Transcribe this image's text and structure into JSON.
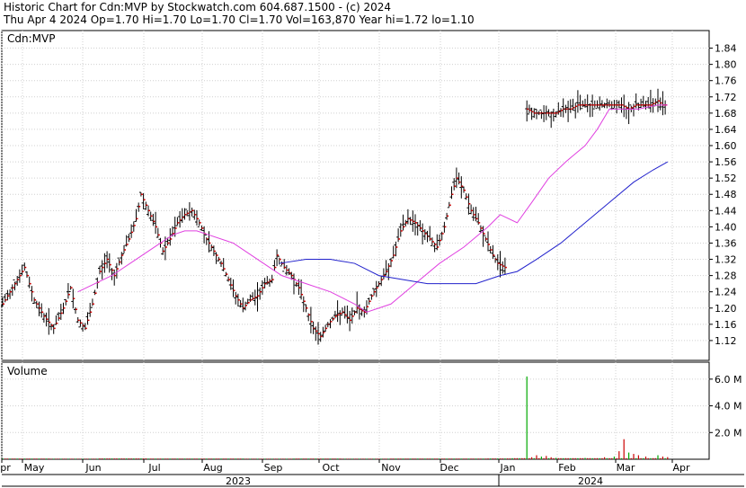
{
  "header": {
    "line1": "Historic Chart for Cdn:MVP by Stockwatch.com 604.687.1500 - (c) 2024",
    "line2": "Thu Apr  4 2024   Op=1.70  Hi=1.70  Lo=1.70  Cl=1.70  Vol=163,870  Year hi=1.72  lo=1.10"
  },
  "chart_data": [
    {
      "type": "ohlc",
      "title": "Cdn:MVP",
      "ylim": [
        1.08,
        1.87
      ],
      "y_ticks": [
        "1.84",
        "1.80",
        "1.76",
        "1.72",
        "1.68",
        "1.64",
        "1.60",
        "1.56",
        "1.52",
        "1.48",
        "1.44",
        "1.40",
        "1.36",
        "1.32",
        "1.28",
        "1.24",
        "1.20",
        "1.16",
        "1.12"
      ],
      "grid": true,
      "x_months": [
        "pr",
        "May",
        "Jun",
        "Jul",
        "Aug",
        "Sep",
        "Oct",
        "Nov",
        "Dec",
        "Jan",
        "Feb",
        "Mar",
        "Apr"
      ],
      "x_years": [
        "2023",
        "2024"
      ],
      "colors": {
        "bar": "#000000",
        "close_tick": "#cc0000",
        "ma_short": "#e040e0",
        "ma_long": "#2222cc",
        "grid": "#d0d0d0"
      },
      "price_path": [
        [
          0,
          1.21
        ],
        [
          5,
          1.26
        ],
        [
          9,
          1.3
        ],
        [
          13,
          1.22
        ],
        [
          17,
          1.18
        ],
        [
          21,
          1.15
        ],
        [
          25,
          1.2
        ],
        [
          28,
          1.25
        ],
        [
          31,
          1.17
        ],
        [
          34,
          1.15
        ],
        [
          37,
          1.21
        ],
        [
          40,
          1.29
        ],
        [
          43,
          1.32
        ],
        [
          46,
          1.28
        ],
        [
          49,
          1.33
        ],
        [
          52,
          1.37
        ],
        [
          55,
          1.42
        ],
        [
          57,
          1.48
        ],
        [
          60,
          1.44
        ],
        [
          63,
          1.4
        ],
        [
          66,
          1.34
        ],
        [
          69,
          1.37
        ],
        [
          72,
          1.41
        ],
        [
          75,
          1.43
        ],
        [
          78,
          1.44
        ],
        [
          81,
          1.41
        ],
        [
          84,
          1.37
        ],
        [
          87,
          1.34
        ],
        [
          90,
          1.31
        ],
        [
          93,
          1.27
        ],
        [
          96,
          1.23
        ],
        [
          99,
          1.2
        ],
        [
          102,
          1.22
        ],
        [
          105,
          1.23
        ],
        [
          108,
          1.26
        ],
        [
          111,
          1.27
        ],
        [
          113,
          1.33
        ],
        [
          116,
          1.3
        ],
        [
          119,
          1.28
        ],
        [
          122,
          1.25
        ],
        [
          125,
          1.2
        ],
        [
          128,
          1.15
        ],
        [
          131,
          1.13
        ],
        [
          134,
          1.16
        ],
        [
          137,
          1.18
        ],
        [
          140,
          1.19
        ],
        [
          143,
          1.17
        ],
        [
          146,
          1.2
        ],
        [
          149,
          1.19
        ],
        [
          152,
          1.23
        ],
        [
          155,
          1.26
        ],
        [
          158,
          1.29
        ],
        [
          161,
          1.33
        ],
        [
          164,
          1.39
        ],
        [
          167,
          1.42
        ],
        [
          170,
          1.41
        ],
        [
          173,
          1.39
        ],
        [
          176,
          1.37
        ],
        [
          179,
          1.35
        ],
        [
          182,
          1.4
        ],
        [
          185,
          1.48
        ],
        [
          187,
          1.52
        ],
        [
          190,
          1.49
        ],
        [
          193,
          1.44
        ],
        [
          196,
          1.41
        ],
        [
          199,
          1.37
        ],
        [
          202,
          1.33
        ],
        [
          204,
          1.31
        ],
        [
          207,
          1.3
        ],
        [
          208,
          1.31
        ]
      ],
      "price_path_late": [
        [
          216,
          1.69
        ],
        [
          219,
          1.68
        ],
        [
          222,
          1.68
        ],
        [
          225,
          1.68
        ],
        [
          228,
          1.68
        ],
        [
          231,
          1.69
        ],
        [
          234,
          1.69
        ],
        [
          237,
          1.7
        ],
        [
          240,
          1.7
        ],
        [
          243,
          1.7
        ],
        [
          246,
          1.7
        ],
        [
          249,
          1.7
        ],
        [
          252,
          1.7
        ],
        [
          255,
          1.7
        ],
        [
          258,
          1.69
        ],
        [
          261,
          1.7
        ],
        [
          264,
          1.7
        ],
        [
          267,
          1.7
        ],
        [
          270,
          1.71
        ],
        [
          272,
          1.7
        ],
        [
          274,
          1.7
        ]
      ],
      "ma_short": [
        [
          31,
          1.24
        ],
        [
          45,
          1.28
        ],
        [
          55,
          1.32
        ],
        [
          65,
          1.36
        ],
        [
          70,
          1.38
        ],
        [
          75,
          1.39
        ],
        [
          80,
          1.39
        ],
        [
          85,
          1.38
        ],
        [
          95,
          1.36
        ],
        [
          105,
          1.32
        ],
        [
          115,
          1.28
        ],
        [
          125,
          1.26
        ],
        [
          135,
          1.24
        ],
        [
          145,
          1.21
        ],
        [
          150,
          1.19
        ],
        [
          160,
          1.21
        ],
        [
          170,
          1.26
        ],
        [
          180,
          1.31
        ],
        [
          190,
          1.35
        ],
        [
          200,
          1.4
        ],
        [
          205,
          1.43
        ],
        [
          212,
          1.41
        ],
        [
          218,
          1.46
        ],
        [
          225,
          1.52
        ],
        [
          232,
          1.56
        ],
        [
          240,
          1.6
        ],
        [
          245,
          1.64
        ],
        [
          250,
          1.69
        ],
        [
          255,
          1.69
        ],
        [
          262,
          1.69
        ],
        [
          270,
          1.7
        ],
        [
          274,
          1.7
        ]
      ],
      "ma_long": [
        [
          114,
          1.31
        ],
        [
          125,
          1.32
        ],
        [
          135,
          1.32
        ],
        [
          145,
          1.31
        ],
        [
          155,
          1.28
        ],
        [
          165,
          1.27
        ],
        [
          175,
          1.26
        ],
        [
          185,
          1.26
        ],
        [
          195,
          1.26
        ],
        [
          205,
          1.28
        ],
        [
          212,
          1.29
        ],
        [
          220,
          1.32
        ],
        [
          230,
          1.36
        ],
        [
          240,
          1.41
        ],
        [
          250,
          1.46
        ],
        [
          260,
          1.51
        ],
        [
          268,
          1.54
        ],
        [
          274,
          1.56
        ]
      ]
    },
    {
      "type": "bar",
      "title": "Volume",
      "ylim": [
        0,
        7.0
      ],
      "y_ticks": [
        "6.0 M",
        "4.0 M",
        "2.0 M"
      ],
      "note_units": "millions of shares",
      "volume_points": [
        [
          0,
          0.05
        ],
        [
          20,
          0.04
        ],
        [
          40,
          0.06
        ],
        [
          60,
          0.05
        ],
        [
          80,
          0.05
        ],
        [
          100,
          0.04
        ],
        [
          120,
          0.05
        ],
        [
          140,
          0.04
        ],
        [
          160,
          0.05
        ],
        [
          180,
          0.05
        ],
        [
          200,
          0.06
        ],
        [
          210,
          0.08
        ],
        [
          216,
          6.2
        ],
        [
          218,
          0.15
        ],
        [
          220,
          0.3
        ],
        [
          222,
          0.2
        ],
        [
          224,
          0.25
        ],
        [
          226,
          0.15
        ],
        [
          228,
          0.1
        ],
        [
          232,
          0.08
        ],
        [
          240,
          0.1
        ],
        [
          248,
          0.15
        ],
        [
          252,
          0.2
        ],
        [
          254,
          0.6
        ],
        [
          256,
          1.5
        ],
        [
          258,
          0.5
        ],
        [
          260,
          0.4
        ],
        [
          262,
          0.3
        ],
        [
          265,
          0.2
        ],
        [
          270,
          0.3
        ],
        [
          272,
          0.2
        ],
        [
          274,
          0.16
        ]
      ]
    }
  ]
}
